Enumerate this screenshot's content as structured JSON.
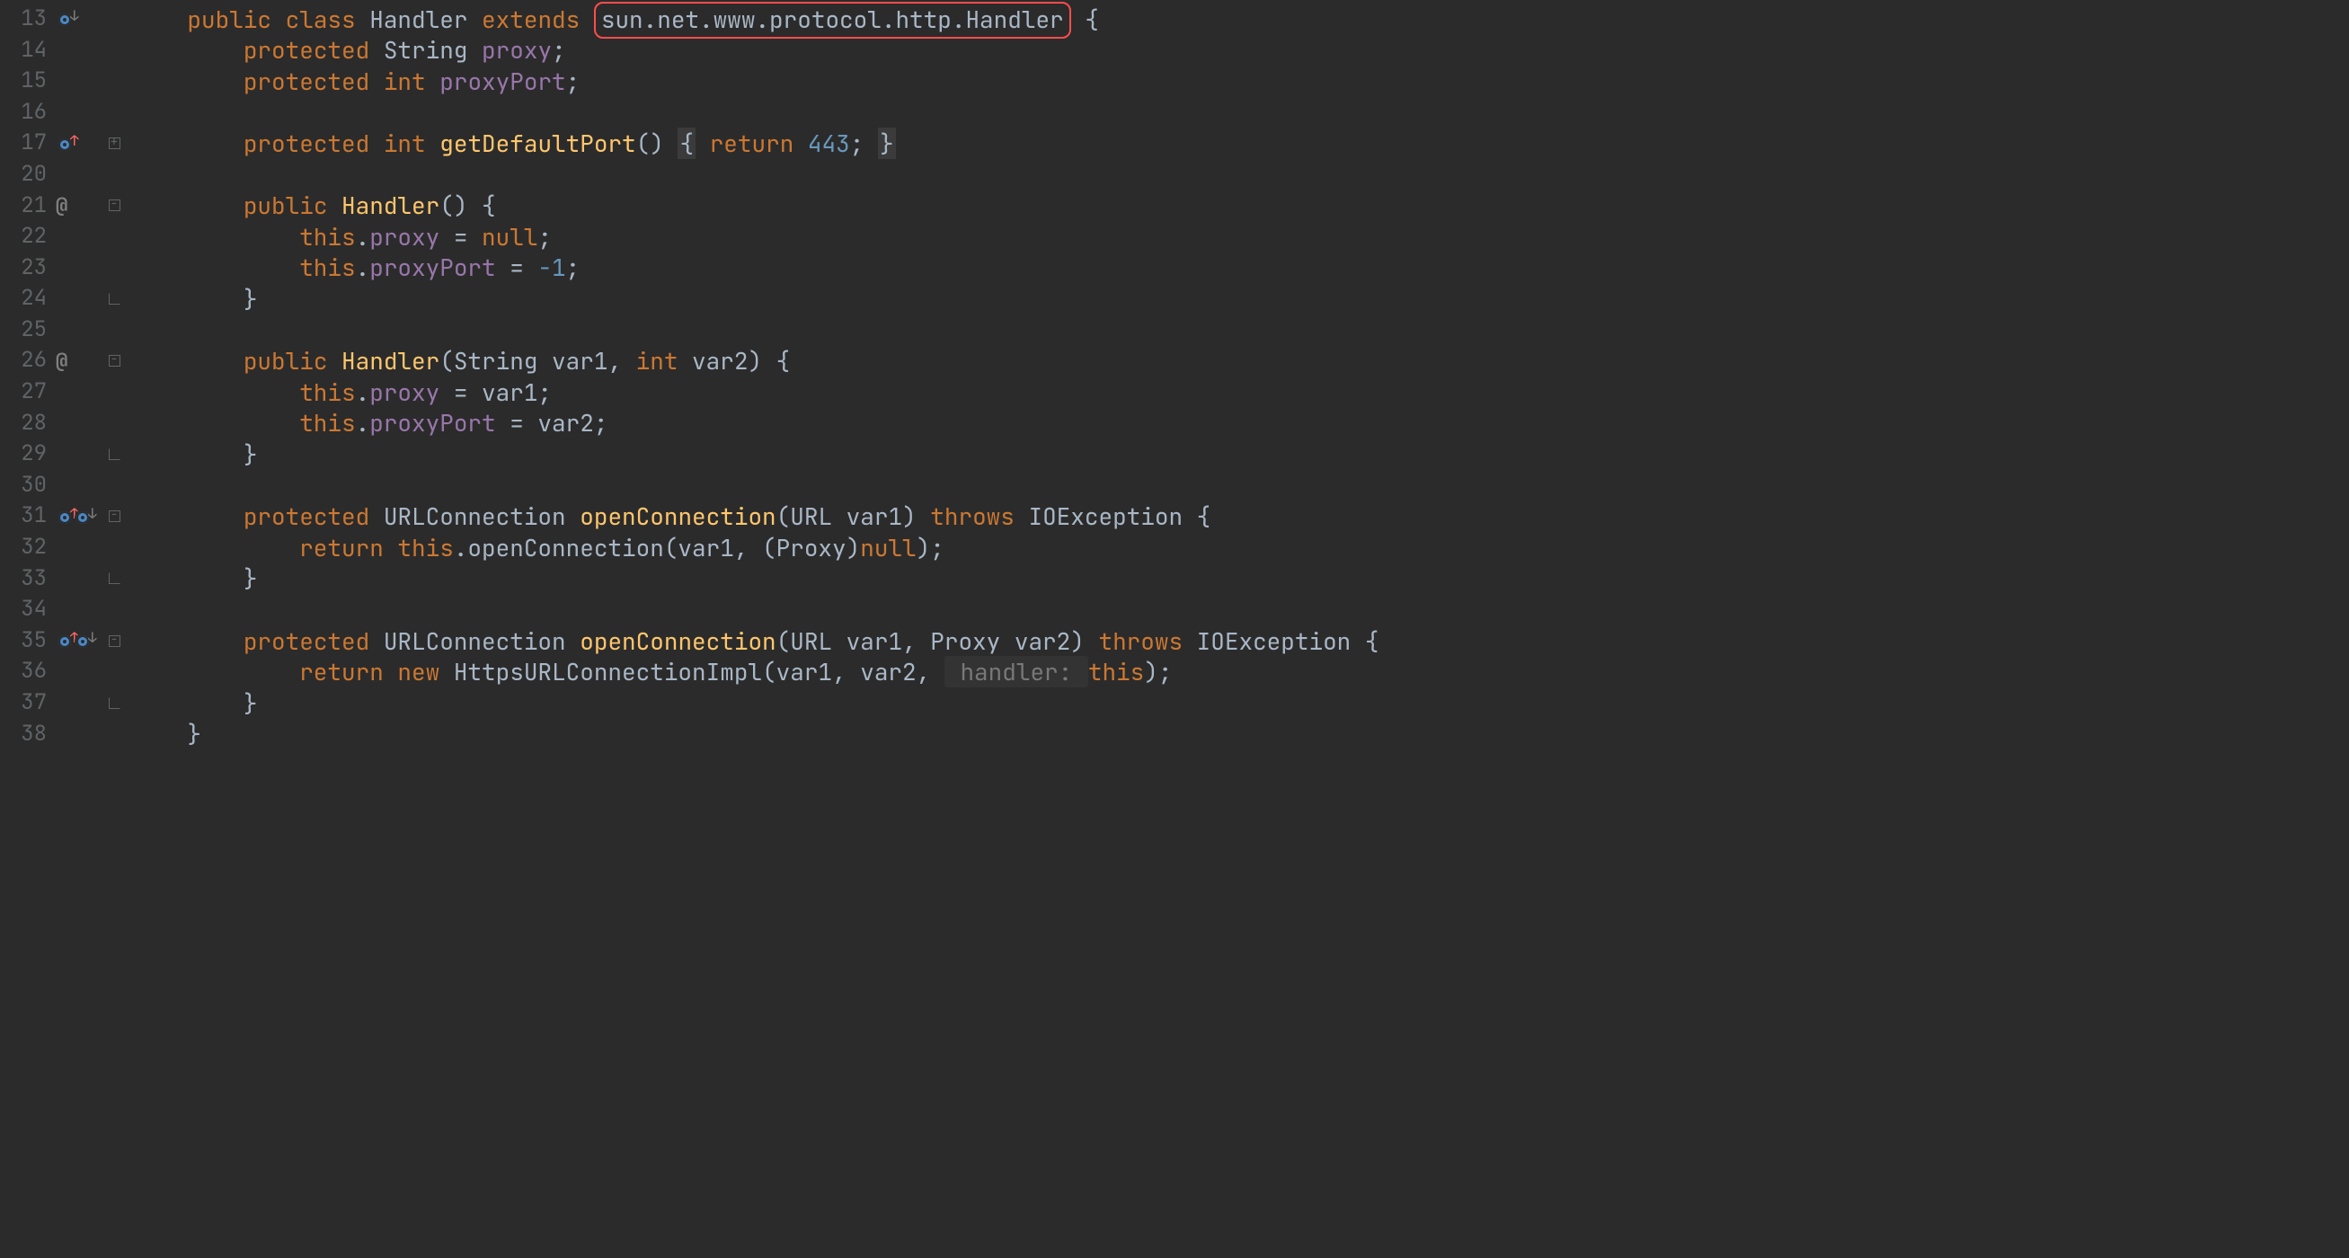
{
  "lines": [
    {
      "n": "13",
      "markers": [
        "override-down"
      ],
      "fold": "",
      "indent": "    ",
      "tokens": [
        [
          "kw",
          "public"
        ],
        [
          "",
          ""
        ],
        [
          "kw",
          " class"
        ],
        [
          "",
          " "
        ],
        [
          "type",
          "Handler"
        ],
        [
          "",
          " "
        ],
        [
          "kw",
          "extends"
        ],
        [
          "",
          " "
        ],
        [
          "boxed",
          "sun.net.www.protocol.http.Handler"
        ],
        [
          "",
          " {"
        ]
      ]
    },
    {
      "n": "14",
      "markers": [],
      "fold": "",
      "indent": "        ",
      "tokens": [
        [
          "kw",
          "protected"
        ],
        [
          "",
          " "
        ],
        [
          "type",
          "String"
        ],
        [
          "",
          " "
        ],
        [
          "field",
          "proxy"
        ],
        [
          "",
          ";"
        ]
      ]
    },
    {
      "n": "15",
      "markers": [],
      "fold": "",
      "indent": "        ",
      "tokens": [
        [
          "kw",
          "protected"
        ],
        [
          "",
          " "
        ],
        [
          "kw",
          "int"
        ],
        [
          "",
          " "
        ],
        [
          "field",
          "proxyPort"
        ],
        [
          "",
          ";"
        ]
      ]
    },
    {
      "n": "16",
      "markers": [],
      "fold": "",
      "indent": "",
      "tokens": []
    },
    {
      "n": "17",
      "markers": [
        "override-up"
      ],
      "fold": "plus",
      "indent": "        ",
      "tokens": [
        [
          "kw",
          "protected"
        ],
        [
          "",
          " "
        ],
        [
          "kw",
          "int"
        ],
        [
          "",
          " "
        ],
        [
          "fn",
          "getDefaultPort"
        ],
        [
          "",
          "() "
        ],
        [
          "dimb",
          "{"
        ],
        [
          "",
          " "
        ],
        [
          "kw",
          "return"
        ],
        [
          "",
          " "
        ],
        [
          "num",
          "443"
        ],
        [
          "",
          ";"
        ],
        [
          "",
          " "
        ],
        [
          "dimb",
          "}"
        ]
      ]
    },
    {
      "n": "20",
      "markers": [],
      "fold": "",
      "indent": "",
      "tokens": []
    },
    {
      "n": "21",
      "markers": [
        "at"
      ],
      "fold": "minus",
      "indent": "        ",
      "tokens": [
        [
          "kw",
          "public"
        ],
        [
          "",
          " "
        ],
        [
          "fn",
          "Handler"
        ],
        [
          "",
          "() {"
        ]
      ]
    },
    {
      "n": "22",
      "markers": [],
      "fold": "",
      "indent": "            ",
      "tokens": [
        [
          "kw",
          "this"
        ],
        [
          "",
          "."
        ],
        [
          "field",
          "proxy"
        ],
        [
          "",
          " = "
        ],
        [
          "kw",
          "null"
        ],
        [
          "",
          ";"
        ]
      ]
    },
    {
      "n": "23",
      "markers": [],
      "fold": "",
      "indent": "            ",
      "tokens": [
        [
          "kw",
          "this"
        ],
        [
          "",
          "."
        ],
        [
          "field",
          "proxyPort"
        ],
        [
          "",
          " = "
        ],
        [
          "num",
          "-1"
        ],
        [
          "",
          ";"
        ]
      ]
    },
    {
      "n": "24",
      "markers": [],
      "fold": "end",
      "indent": "        ",
      "tokens": [
        [
          "",
          "}"
        ]
      ]
    },
    {
      "n": "25",
      "markers": [],
      "fold": "",
      "indent": "",
      "tokens": []
    },
    {
      "n": "26",
      "markers": [
        "at"
      ],
      "fold": "minus",
      "indent": "        ",
      "tokens": [
        [
          "kw",
          "public"
        ],
        [
          "",
          " "
        ],
        [
          "fn",
          "Handler"
        ],
        [
          "",
          "(String var1, "
        ],
        [
          "kw",
          "int"
        ],
        [
          "",
          " var2) {"
        ]
      ]
    },
    {
      "n": "27",
      "markers": [],
      "fold": "",
      "indent": "            ",
      "tokens": [
        [
          "kw",
          "this"
        ],
        [
          "",
          "."
        ],
        [
          "field",
          "proxy"
        ],
        [
          "",
          " = var1;"
        ]
      ]
    },
    {
      "n": "28",
      "markers": [],
      "fold": "",
      "indent": "            ",
      "tokens": [
        [
          "kw",
          "this"
        ],
        [
          "",
          "."
        ],
        [
          "field",
          "proxyPort"
        ],
        [
          "",
          " = var2;"
        ]
      ]
    },
    {
      "n": "29",
      "markers": [],
      "fold": "end",
      "indent": "        ",
      "tokens": [
        [
          "",
          "}"
        ]
      ]
    },
    {
      "n": "30",
      "markers": [],
      "fold": "",
      "indent": "",
      "tokens": []
    },
    {
      "n": "31",
      "markers": [
        "override-up",
        "override-down"
      ],
      "fold": "minus",
      "indent": "        ",
      "tokens": [
        [
          "kw",
          "protected"
        ],
        [
          "",
          " "
        ],
        [
          "type",
          "URLConnection"
        ],
        [
          "",
          " "
        ],
        [
          "fn",
          "openConnection"
        ],
        [
          "",
          "(URL var1) "
        ],
        [
          "kw",
          "throws"
        ],
        [
          "",
          " IOException {"
        ]
      ]
    },
    {
      "n": "32",
      "markers": [],
      "fold": "",
      "indent": "            ",
      "tokens": [
        [
          "kw",
          "return"
        ],
        [
          "",
          " "
        ],
        [
          "kw",
          "this"
        ],
        [
          "",
          ".openConnection(var1, (Proxy)"
        ],
        [
          "kw",
          "null"
        ],
        [
          "",
          ");"
        ]
      ]
    },
    {
      "n": "33",
      "markers": [],
      "fold": "end",
      "indent": "        ",
      "tokens": [
        [
          "",
          "}"
        ]
      ]
    },
    {
      "n": "34",
      "markers": [],
      "fold": "",
      "indent": "",
      "tokens": []
    },
    {
      "n": "35",
      "markers": [
        "override-up",
        "override-down"
      ],
      "fold": "minus",
      "indent": "        ",
      "tokens": [
        [
          "kw",
          "protected"
        ],
        [
          "",
          " "
        ],
        [
          "type",
          "URLConnection"
        ],
        [
          "",
          " "
        ],
        [
          "fn",
          "openConnection"
        ],
        [
          "",
          "(URL var1, Proxy var2) "
        ],
        [
          "kw",
          "throws"
        ],
        [
          "",
          " IOException {"
        ]
      ]
    },
    {
      "n": "36",
      "markers": [],
      "fold": "",
      "indent": "            ",
      "tokens": [
        [
          "kw",
          "return"
        ],
        [
          "",
          " "
        ],
        [
          "kw",
          "new"
        ],
        [
          "",
          " HttpsURLConnectionImpl(var1, var2, "
        ],
        [
          "hint",
          " handler: "
        ],
        [
          "kw",
          "this"
        ],
        [
          "",
          ");"
        ]
      ]
    },
    {
      "n": "37",
      "markers": [],
      "fold": "end",
      "indent": "        ",
      "tokens": [
        [
          "",
          "}"
        ]
      ]
    },
    {
      "n": "38",
      "markers": [],
      "fold": "",
      "indent": "    ",
      "tokens": [
        [
          "",
          "}"
        ]
      ]
    }
  ]
}
